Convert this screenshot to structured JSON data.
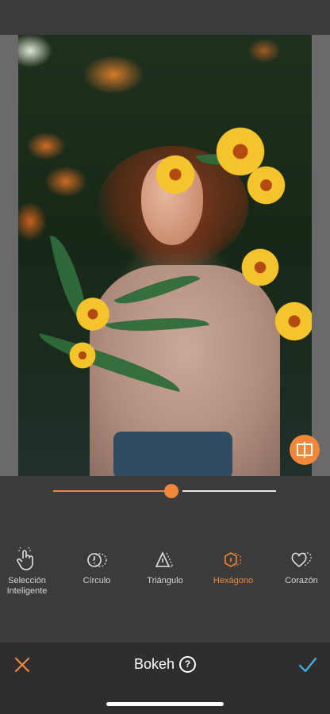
{
  "slider": {
    "value_fraction": 0.53
  },
  "tools": [
    {
      "label": "Selección Inteligente",
      "icon": "hand-pointer-icon",
      "active": false
    },
    {
      "label": "Círculo",
      "icon": "circle-bokeh-icon",
      "active": false
    },
    {
      "label": "Triángulo",
      "icon": "triangle-bokeh-icon",
      "active": false
    },
    {
      "label": "Hexágono",
      "icon": "hexagon-bokeh-icon",
      "active": true
    },
    {
      "label": "Corazón",
      "icon": "heart-bokeh-icon",
      "active": false
    }
  ],
  "bottom_bar": {
    "title": "Bokeh",
    "help_label": "?"
  },
  "colors": {
    "accent": "#f0873a",
    "confirm": "#3fb6e6",
    "background": "#3b3b3b"
  }
}
